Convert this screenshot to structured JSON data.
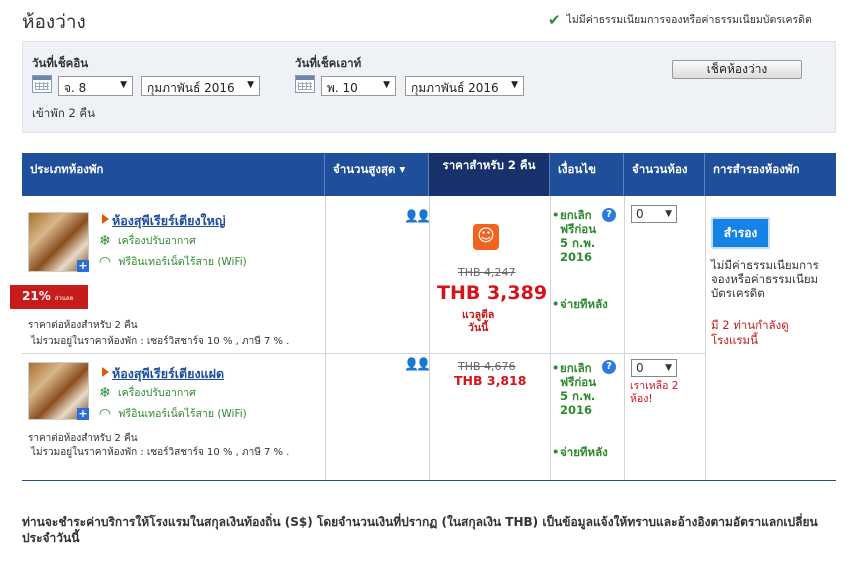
{
  "header": {
    "title": "ห้องว่าง",
    "no_fee_note": "ไม่มีค่าธรรมเนียมการจองหรือค่าธรรมเนียมบัตรเครดิต"
  },
  "search": {
    "checkin_label": "วันที่เช็คอิน",
    "checkin_day": "จ. 8",
    "checkin_month": "กุมภาพันธ์ 2016",
    "checkout_label": "วันที่เช็คเอาท์",
    "checkout_day": "พ. 10",
    "checkout_month": "กุมภาพันธ์ 2016",
    "nights_text": "เข้าพัก 2 คืน",
    "check_button": "เช็คห้องว่าง"
  },
  "table": {
    "columns": {
      "room_type": "ประเภทห้องพัก",
      "max_guests": "จำนวนสูงสุด ▾",
      "price": "ราคาสำหรับ 2 คืน",
      "conditions": "เงื่อนไข",
      "rooms": "จำนวนห้อง",
      "booking": "การสำรองห้องพัก"
    },
    "rooms": [
      {
        "name": "ห้องสุพีเรียร์เตียงใหญ่",
        "amenity_ac": "เครื่องปรับอากาศ",
        "amenity_wifi": "ฟรีอินเทอร์เน็ตไร้สาย (WiFi)",
        "discount_badge": "21%",
        "discount_suffix": "ส่วนลด",
        "price_note": "ราคาต่อห้องสำหรับ 2 คืน",
        "tax_note": "ไม่รวมอยู่ในราคาห้องพัก : เซอร์วิสชาร์จ 10 % , ภาษี 7 % .",
        "old_price": "THB 4,247",
        "new_price": "THB 3,389",
        "deal_text1": "แวลูดีล",
        "deal_text2": "วันนี้",
        "cond1": "ยกเลิกฟรีก่อน 5 ก.พ. 2016",
        "cond2": "จ่ายทีหลัง",
        "qty": "0",
        "book_button": "สำรอง",
        "no_fee_text": "ไม่มีค่าธรรมเนียมการจองหรือค่าธรรมเนียมบัตรเครดิต",
        "viewers_text": "มี 2 ท่านกำลังดูโรงแรมนี้"
      },
      {
        "name": "ห้องสุพีเรียร์เตียงแฝด",
        "amenity_ac": "เครื่องปรับอากาศ",
        "amenity_wifi": "ฟรีอินเทอร์เน็ตไร้สาย (WiFi)",
        "price_note": "ราคาต่อห้องสำหรับ 2 คืน",
        "tax_note": "ไม่รวมอยู่ในราคาห้องพัก : เซอร์วิสชาร์จ 10 % , ภาษี 7 % .",
        "old_price": "THB 4,676",
        "new_price": "THB 3,818",
        "cond1": "ยกเลิกฟรีก่อน 5 ก.พ. 2016",
        "cond2": "จ่ายทีหลัง",
        "qty": "0",
        "rooms_left": "เราเหลือ 2 ห้อง!"
      }
    ]
  },
  "footnote": "ท่านจะชำระค่าบริการให้โรงแรมในสกุลเงินท้องถิ่น (S$) โดยจำนวนเงินที่ปรากฏ (ในสกุลเงิน THB) เป็นข้อมูลแจ้งให้ทราบและอ้างอิงตามอัตราแลกเปลี่ยนประจำวันนี้",
  "colors": {
    "header_blue": "#1f4e9a",
    "active_col": "#17326b",
    "price_red": "#d4141b",
    "green": "#2d8a2d",
    "book_blue": "#1682e8"
  }
}
